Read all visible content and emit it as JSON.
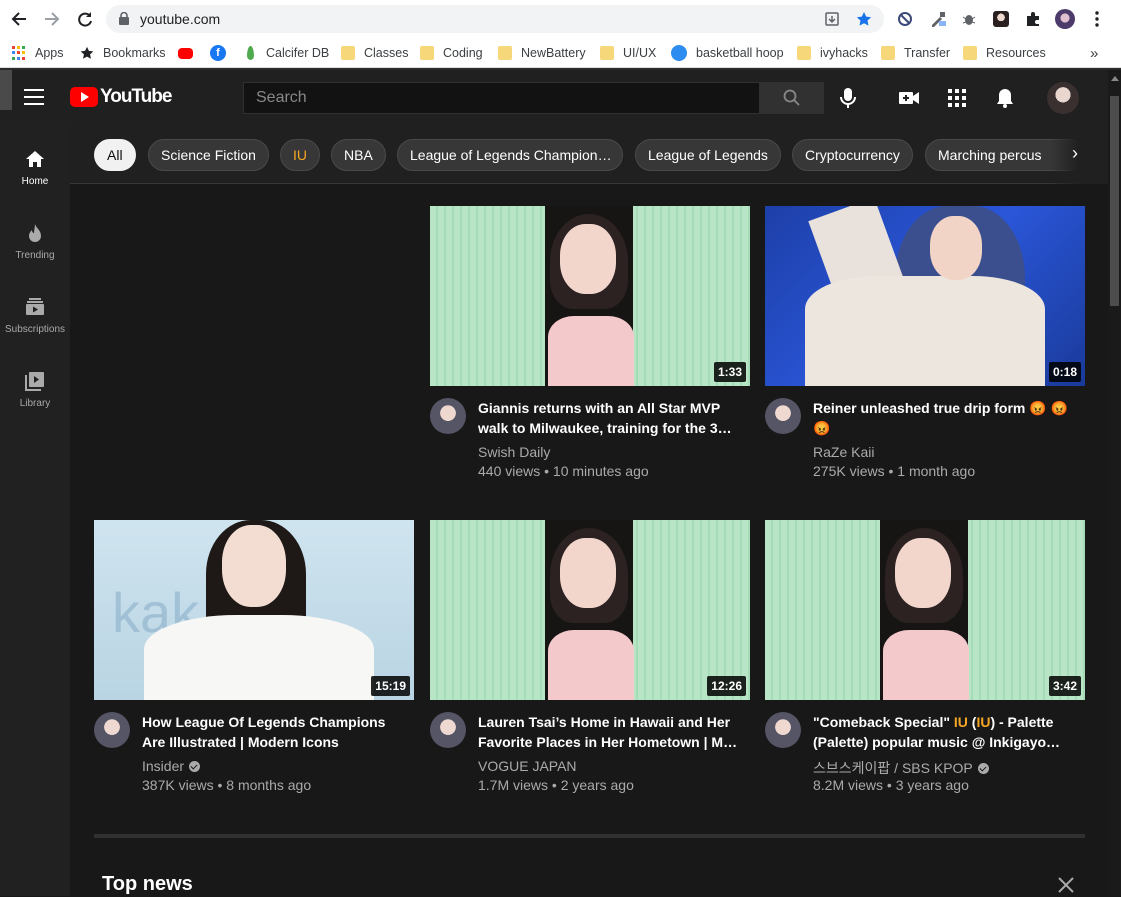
{
  "browser": {
    "url": "youtube.com",
    "bookmarks": [
      {
        "label": "Apps",
        "icon": "apps-grid-icon"
      },
      {
        "label": "Bookmarks",
        "icon": "star-icon"
      },
      {
        "label": "",
        "icon": "youtube-icon"
      },
      {
        "label": "",
        "icon": "facebook-icon"
      },
      {
        "label": "Calcifer DB",
        "icon": "mongodb-leaf-icon"
      },
      {
        "label": "Classes",
        "icon": "folder-icon"
      },
      {
        "label": "Coding",
        "icon": "folder-icon"
      },
      {
        "label": "NewBattery",
        "icon": "folder-icon"
      },
      {
        "label": "UI/UX",
        "icon": "folder-icon"
      },
      {
        "label": "basketball hoop",
        "icon": "site-icon"
      },
      {
        "label": "ivyhacks",
        "icon": "folder-icon"
      },
      {
        "label": "Transfer",
        "icon": "folder-icon"
      },
      {
        "label": "Resources",
        "icon": "folder-icon"
      }
    ],
    "more_bookmarks": "»"
  },
  "header": {
    "logo_text": "YouTube",
    "search_placeholder": "Search"
  },
  "sidebar": {
    "items": [
      {
        "label": "Home",
        "icon": "home-icon"
      },
      {
        "label": "Trending",
        "icon": "fire-icon"
      },
      {
        "label": "Subscriptions",
        "icon": "subscriptions-icon"
      },
      {
        "label": "Library",
        "icon": "library-icon"
      }
    ]
  },
  "chips": [
    "All",
    "Science Fiction",
    "IU",
    "NBA",
    "League of Legends Champion…",
    "League of Legends",
    "Cryptocurrency",
    "Marching percus"
  ],
  "videos": [
    {
      "title": "Giannis returns with an All Star MVP walk to Milwaukee, training for the 3…",
      "channel": "Swish Daily",
      "stats": "440 views • 10 minutes ago",
      "duration": "1:33"
    },
    {
      "title": "Reiner unleashed true drip form 😡 😡 😡",
      "channel": "RaZe Kaii",
      "stats": "275K views • 1 month ago",
      "duration": "0:18"
    },
    {
      "title": "How League Of Legends Champions Are Illustrated | Modern Icons",
      "channel": "Insider",
      "stats": "387K views • 8 months ago",
      "duration": "15:19"
    },
    {
      "title": "Lauren Tsai’s Home in Hawaii and Her Favorite Places in Her Hometown | M…",
      "channel": "VOGUE JAPAN",
      "stats": "1.7M views • 2 years ago",
      "duration": "12:26"
    },
    {
      "title_parts": [
        "\"Comeback Special\" ",
        "IU",
        " (",
        "IU",
        ") - Palette (Palette) popular music @ Inkigayo…"
      ],
      "channel": "스브스케이팝 / SBS KPOP",
      "stats": "8.2M views • 3 years ago",
      "duration": "3:42"
    }
  ],
  "sections": {
    "top_news": "Top news"
  },
  "colors": {
    "accent": "#ff0000",
    "chip_highlight": "#f5a623",
    "background": "#181818"
  }
}
